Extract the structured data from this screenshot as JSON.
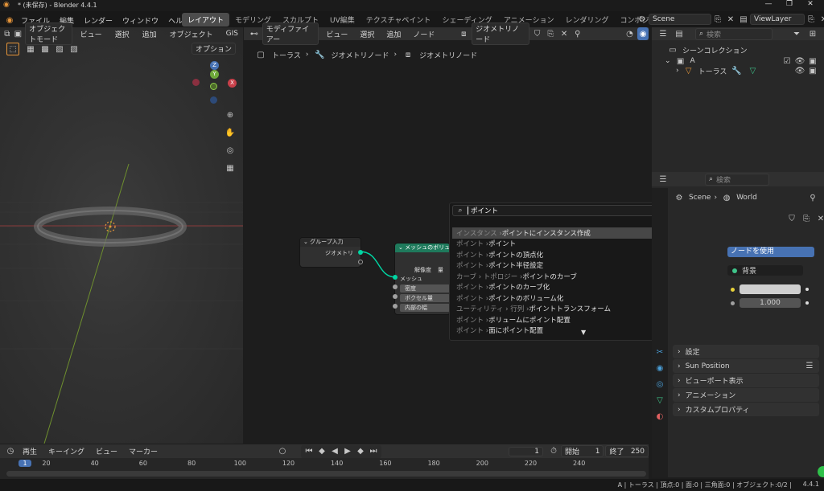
{
  "window": {
    "title": "* (未保存) - Blender 4.4.1"
  },
  "menu": {
    "items": [
      "ファイル",
      "編集",
      "レンダー",
      "ウィンドウ",
      "ヘルプ"
    ]
  },
  "workspaces": [
    "レイアウト",
    "モデリング",
    "スカルプト",
    "UV編集",
    "テクスチャペイント",
    "シェーディング",
    "アニメーション",
    "レンダリング",
    "コンポジティング"
  ],
  "active_workspace": "レイアウト",
  "scene": {
    "name": "Scene",
    "view_layer": "ViewLayer"
  },
  "viewport": {
    "mode": "オブジェクトモード",
    "menus": [
      "ビュー",
      "選択",
      "追加",
      "オブジェクト",
      "GIS"
    ],
    "options_label": "オプション",
    "gizmo": {
      "z": "Z",
      "x": "X",
      "y": "Y"
    }
  },
  "node_editor": {
    "type": "モディファイアー",
    "menus": [
      "ビュー",
      "選択",
      "追加",
      "ノード"
    ],
    "tree_name": "ジオメトリノード",
    "breadcrumb": [
      "トーラス",
      "ジオメトリノード",
      "ジオメトリノード"
    ],
    "group_input": {
      "title": "グループ入力",
      "socket": "ジオメトリ"
    },
    "mesh_node": {
      "title": "メッシュのボリュー",
      "resolution_label": "解像度",
      "resolution_value": "量",
      "output": "メッシュ",
      "fields": [
        "密度",
        "ボクセル量",
        "内部の幅"
      ]
    }
  },
  "search": {
    "query": "ポイント",
    "results": [
      {
        "prefix": "インスタンス › ",
        "label": "ポイントにインスタンス作成"
      },
      {
        "prefix": "ポイント › ",
        "label": "ポイント"
      },
      {
        "prefix": "ポイント › ",
        "label": "ポイントの頂点化"
      },
      {
        "prefix": "ポイント › ",
        "label": "ポイント半径設定"
      },
      {
        "prefix": "カーブ › トポロジー › ",
        "label": "ポイントのカーブ"
      },
      {
        "prefix": "ポイント › ",
        "label": "ポイントのカーブ化"
      },
      {
        "prefix": "ポイント › ",
        "label": "ポイントのボリューム化"
      },
      {
        "prefix": "ユーティリティ › 行列 › ",
        "label": "ポイントトランスフォーム"
      },
      {
        "prefix": "ポイント › ",
        "label": "ボリュームにポイント配置"
      },
      {
        "prefix": "ポイント › ",
        "label": "面にポイント配置"
      }
    ]
  },
  "outliner": {
    "search_placeholder": "検索",
    "scene_collection": "シーンコレクション",
    "collection": "A",
    "object": "トーラス"
  },
  "properties": {
    "search_placeholder": "検索",
    "breadcrumb_scene": "Scene",
    "breadcrumb_world": "World",
    "use_nodes": "ノードを使用",
    "surface": "背景",
    "strength": "1.000",
    "panels": [
      "設定",
      "Sun Position",
      "ビューポート表示",
      "アニメーション",
      "カスタムプロパティ"
    ]
  },
  "timeline": {
    "menus": [
      "再生",
      "キーイング",
      "ビュー",
      "マーカー"
    ],
    "current_frame": "1",
    "start_label": "開始",
    "start": "1",
    "end_label": "終了",
    "end": "250",
    "ticks": [
      "1",
      "20",
      "40",
      "60",
      "80",
      "100",
      "120",
      "140",
      "160",
      "180",
      "200",
      "220",
      "240"
    ]
  },
  "status": {
    "text": "A | トーラス | 頂点:0 | 面:0 | 三角面:0 | オブジェクト:0/2 |",
    "version": "4.4.1"
  },
  "colors": {
    "accent_blue": "#4772b3",
    "node_green": "#1f7a5c",
    "socket_green": "#00d6a3",
    "highlight_orange": "#e7963a"
  }
}
